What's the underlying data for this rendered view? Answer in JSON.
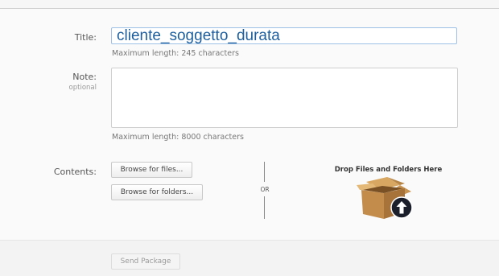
{
  "form": {
    "title_label": "Title:",
    "title_value": "cliente_soggetto_durata",
    "title_hint": "Maximum length: 245 characters",
    "note_label": "Note:",
    "note_sublabel": "optional",
    "note_value": "",
    "note_hint": "Maximum length: 8000 characters",
    "contents_label": "Contents:",
    "browse_files_label": "Browse for files...",
    "browse_folders_label": "Browse for folders...",
    "or_label": "OR",
    "drop_title": "Drop Files and Folders Here",
    "send_label": "Send Package"
  },
  "icons": {
    "drop_box": "cardboard-box-upload-icon"
  },
  "colors": {
    "title_text": "#1d5f9e",
    "input_focus_border": "#9dc0e6"
  }
}
